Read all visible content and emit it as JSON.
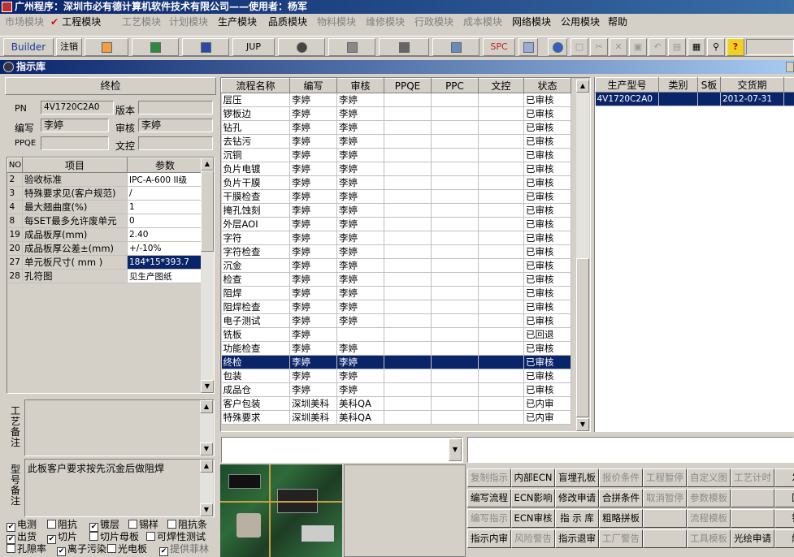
{
  "window": {
    "title": "广州程序：深圳市必有德计算机软件技术有限公司——使用者：杨军"
  },
  "menu": [
    {
      "label": "市场模块",
      "enabled": false
    },
    {
      "label": "工程模块",
      "enabled": true,
      "checked": true
    },
    {
      "label": "工艺模块",
      "enabled": false
    },
    {
      "label": "计划模块",
      "enabled": false
    },
    {
      "label": "生产模块",
      "enabled": true
    },
    {
      "label": "品质模块",
      "enabled": true
    },
    {
      "label": "物料模块",
      "enabled": false
    },
    {
      "label": "维修模块",
      "enabled": false
    },
    {
      "label": "行政模块",
      "enabled": false
    },
    {
      "label": "成本模块",
      "enabled": false
    },
    {
      "label": "网络模块",
      "enabled": true
    },
    {
      "label": "公用模块",
      "enabled": true
    },
    {
      "label": "帮助",
      "enabled": true
    }
  ],
  "toolbar": {
    "builder": "Builder",
    "logout": "注销",
    "jup": "JUP",
    "spc": "SPC"
  },
  "dialog": {
    "title": "指示库"
  },
  "left": {
    "header": "终检",
    "pn_label": "PN",
    "pn": "4V1720C2A0",
    "version_label": "版本",
    "version": "",
    "author_label": "编写",
    "author": "李婷",
    "review_label": "审核",
    "review": "李婷",
    "ppqe_label": "PPQE",
    "ppqe": "",
    "control_label": "文控",
    "control": "",
    "params_headers": {
      "no": "NO",
      "item": "项目",
      "value": "参数"
    },
    "params": [
      {
        "no": "2",
        "item": "验收标准",
        "value": "IPC-A-600 II级"
      },
      {
        "no": "3",
        "item": "特殊要求见(客户规范)",
        "value": "/"
      },
      {
        "no": "4",
        "item": "最大翘曲度(%)",
        "value": "1"
      },
      {
        "no": "8",
        "item": "每SET最多允许废单元",
        "value": "0"
      },
      {
        "no": "19",
        "item": "成品板厚(mm)",
        "value": "2.40"
      },
      {
        "no": "20",
        "item": "成品板厚公差±(mm)",
        "value": "+/-10%"
      },
      {
        "no": "27",
        "item": "单元板尺寸( mm )",
        "value": "184*15*393.7"
      },
      {
        "no": "28",
        "item": "孔符图",
        "value": "见生产图纸"
      }
    ],
    "process_note_label": "工艺备注",
    "process_note": "",
    "model_note_label": "型号备注",
    "model_note": "此板客户要求按先沉金后做阻焊",
    "checkboxes": [
      {
        "label": "电测",
        "checked": true
      },
      {
        "label": "阻抗",
        "checked": false
      },
      {
        "label": "镀层",
        "checked": true
      },
      {
        "label": "锡样",
        "checked": false
      },
      {
        "label": "阻抗条",
        "checked": false
      },
      {
        "label": "出货",
        "checked": true
      },
      {
        "label": "切片",
        "checked": true
      },
      {
        "label": "切片母板",
        "checked": false
      },
      {
        "label": "可焊性测试",
        "checked": false
      },
      {
        "label": "孔隙率",
        "checked": false
      },
      {
        "label": "离子污染",
        "checked": true
      },
      {
        "label": "光电板",
        "checked": false
      },
      {
        "label": "提供菲林",
        "checked": true
      }
    ]
  },
  "process_table": {
    "headers": [
      "流程名称",
      "编写",
      "审核",
      "PPQE",
      "PPC",
      "文控",
      "状态"
    ],
    "rows": [
      [
        "层压",
        "李婷",
        "李婷",
        "",
        "",
        "",
        "已审核"
      ],
      [
        "锣板边",
        "李婷",
        "李婷",
        "",
        "",
        "",
        "已审核"
      ],
      [
        "钻孔",
        "李婷",
        "李婷",
        "",
        "",
        "",
        "已审核"
      ],
      [
        "去钻污",
        "李婷",
        "李婷",
        "",
        "",
        "",
        "已审核"
      ],
      [
        "沉铜",
        "李婷",
        "李婷",
        "",
        "",
        "",
        "已审核"
      ],
      [
        "负片电镀",
        "李婷",
        "李婷",
        "",
        "",
        "",
        "已审核"
      ],
      [
        "负片干膜",
        "李婷",
        "李婷",
        "",
        "",
        "",
        "已审核"
      ],
      [
        "干膜检查",
        "李婷",
        "李婷",
        "",
        "",
        "",
        "已审核"
      ],
      [
        "掩孔蚀刻",
        "李婷",
        "李婷",
        "",
        "",
        "",
        "已审核"
      ],
      [
        "外层AOI",
        "李婷",
        "李婷",
        "",
        "",
        "",
        "已审核"
      ],
      [
        "字符",
        "李婷",
        "李婷",
        "",
        "",
        "",
        "已审核"
      ],
      [
        "字符检查",
        "李婷",
        "李婷",
        "",
        "",
        "",
        "已审核"
      ],
      [
        "沉金",
        "李婷",
        "李婷",
        "",
        "",
        "",
        "已审核"
      ],
      [
        "检查",
        "李婷",
        "李婷",
        "",
        "",
        "",
        "已审核"
      ],
      [
        "阻焊",
        "李婷",
        "李婷",
        "",
        "",
        "",
        "已审核"
      ],
      [
        "阻焊检查",
        "李婷",
        "李婷",
        "",
        "",
        "",
        "已审核"
      ],
      [
        "电子测试",
        "李婷",
        "李婷",
        "",
        "",
        "",
        "已审核"
      ],
      [
        "铣板",
        "李婷",
        "",
        "",
        "",
        "",
        "已回退"
      ],
      [
        "功能检查",
        "李婷",
        "李婷",
        "",
        "",
        "",
        "已审核"
      ],
      [
        "终检",
        "李婷",
        "李婷",
        "",
        "",
        "",
        "已审核"
      ],
      [
        "包装",
        "李婷",
        "李婷",
        "",
        "",
        "",
        "已审核"
      ],
      [
        "成品仓",
        "李婷",
        "李婷",
        "",
        "",
        "",
        "已审核"
      ],
      [
        "客户包装",
        "深圳美科",
        "美科QA",
        "",
        "",
        "",
        "已内审"
      ],
      [
        "特殊要求",
        "深圳美科",
        "美科QA",
        "",
        "",
        "",
        "已内审"
      ]
    ],
    "selected_index": 19
  },
  "model_table": {
    "headers": [
      "生产型号",
      "类别",
      "S板",
      "交货期",
      "军"
    ],
    "rows": [
      [
        "4V1720C2A0",
        "",
        "",
        "2012-07-31",
        ""
      ]
    ]
  },
  "buttons": [
    [
      {
        "label": "复制指示",
        "enabled": false
      },
      {
        "label": "内部ECN",
        "enabled": true
      },
      {
        "label": "盲埋孔板",
        "enabled": true
      },
      {
        "label": "报价条件",
        "enabled": false
      },
      {
        "label": "工程暂停",
        "enabled": false
      },
      {
        "label": "自定义图",
        "enabled": false
      },
      {
        "label": "工艺计时",
        "enabled": false
      },
      {
        "label": "发",
        "enabled": true
      }
    ],
    [
      {
        "label": "编写流程",
        "enabled": true
      },
      {
        "label": "ECN影响",
        "enabled": true
      },
      {
        "label": "修改申请",
        "enabled": true
      },
      {
        "label": "合拼条件",
        "enabled": true
      },
      {
        "label": "取消暂停",
        "enabled": false
      },
      {
        "label": "参数模板",
        "enabled": false
      },
      {
        "label": "",
        "enabled": false
      },
      {
        "label": "回",
        "enabled": true
      }
    ],
    [
      {
        "label": "编写指示",
        "enabled": false
      },
      {
        "label": "ECN审核",
        "enabled": true
      },
      {
        "label": "指 示 库",
        "enabled": true
      },
      {
        "label": "粗略拼板",
        "enabled": true
      },
      {
        "label": "",
        "enabled": false
      },
      {
        "label": "流程模板",
        "enabled": false
      },
      {
        "label": "",
        "enabled": false
      },
      {
        "label": "锁",
        "enabled": true
      }
    ],
    [
      {
        "label": "指示内审",
        "enabled": true
      },
      {
        "label": "风险警告",
        "enabled": false
      },
      {
        "label": "指示退审",
        "enabled": true
      },
      {
        "label": "工厂警告",
        "enabled": false
      },
      {
        "label": "",
        "enabled": false
      },
      {
        "label": "工具模板",
        "enabled": false
      },
      {
        "label": "光绘申请",
        "enabled": true
      },
      {
        "label": "解",
        "enabled": true
      }
    ]
  ]
}
